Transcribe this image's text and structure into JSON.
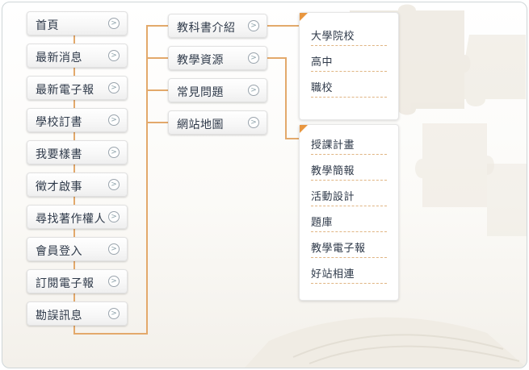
{
  "colors": {
    "connector": "#e3a96b",
    "panel_corner": "#e8963f",
    "text": "#2f3a4a"
  },
  "main_menu": [
    {
      "label": "首頁"
    },
    {
      "label": "最新消息"
    },
    {
      "label": "最新電子報"
    },
    {
      "label": "學校訂書"
    },
    {
      "label": "我要樣書"
    },
    {
      "label": "徵才啟事"
    },
    {
      "label": "尋找著作權人"
    },
    {
      "label": "會員登入"
    },
    {
      "label": "訂閱電子報"
    },
    {
      "label": "勘誤訊息"
    }
  ],
  "second_menu": [
    {
      "label": "教科書介紹"
    },
    {
      "label": "教學資源"
    },
    {
      "label": "常見問題"
    },
    {
      "label": "網站地圖"
    }
  ],
  "textbook_submenu": [
    {
      "label": "大學院校"
    },
    {
      "label": "高中"
    },
    {
      "label": "職校"
    }
  ],
  "resources_submenu": [
    {
      "label": "授課計畫"
    },
    {
      "label": "教學簡報"
    },
    {
      "label": "活動設計"
    },
    {
      "label": "題庫"
    },
    {
      "label": "教學電子報"
    },
    {
      "label": "好站相連"
    }
  ],
  "icons": {
    "arrow": "chevron-right-icon"
  }
}
